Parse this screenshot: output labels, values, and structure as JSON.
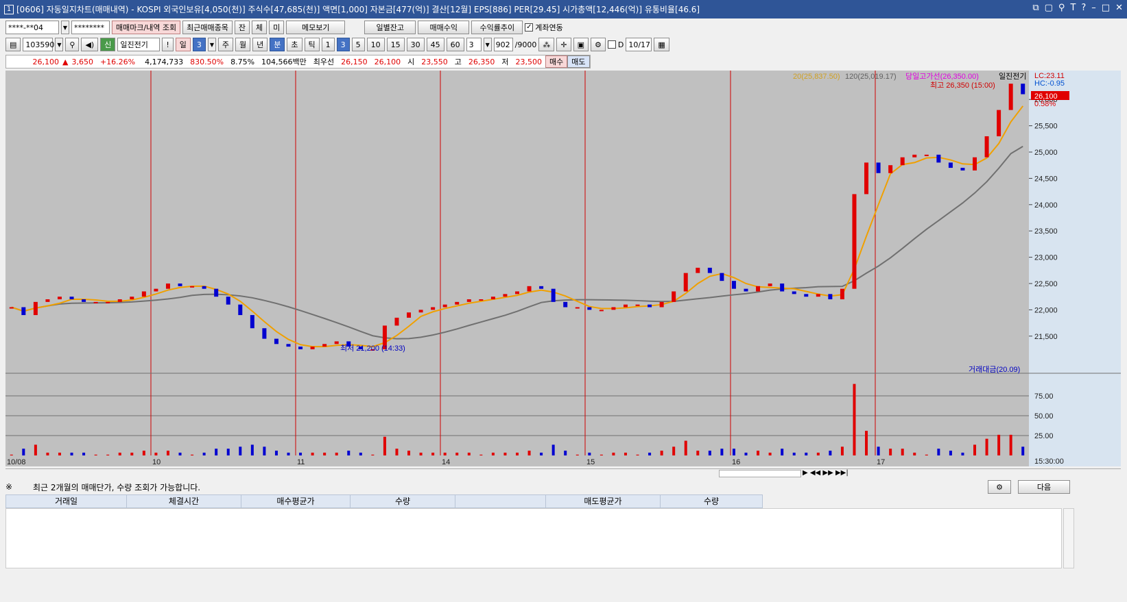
{
  "title": {
    "window_num": "1",
    "text": "[0606] 자동일지차트(매매내역) - KOSPI 외국인보유[4,050(천)] 주식수[47,685(천)] 액면[1,000] 자본금[477(억)] 결산[12월] EPS[886] PER[29.45] 시가총액[12,446(억)] 유통비율[46.6]"
  },
  "toolbar1": {
    "account": "****-**04",
    "password": "********",
    "trade_mark_btn": "매매마크/내역 조회",
    "recent_btn": "최근매매종목",
    "jan": "잔",
    "che": "체",
    "mi": "미",
    "memo_btn": "메모보기",
    "daily_balance_btn": "일별잔고",
    "trade_profit_btn": "매매수익",
    "profit_trend_btn": "수익률추이",
    "account_link_label": "계좌연동"
  },
  "toolbar2": {
    "code": "103590",
    "name": "일진전기",
    "exclam": "!",
    "period_il": "일",
    "period_num": "3",
    "week": "주",
    "month": "월",
    "year": "년",
    "minute": "분",
    "second": "초",
    "tick": "틱",
    "intervals": [
      "1",
      "3",
      "5",
      "10",
      "15",
      "30",
      "45",
      "60"
    ],
    "interval_select": "3",
    "count": "902",
    "count_max": "/9000",
    "d_label": "D",
    "date": "10/17"
  },
  "pricebar": {
    "price": "26,100",
    "change": "3,650",
    "rate": "+16.26%",
    "volume": "4,174,733",
    "vol_rate": "830.50%",
    "turnover": "8.75%",
    "amount": "104,566백만",
    "best_label": "최우선",
    "best_ask": "26,150",
    "best_bid": "26,100",
    "open_label": "시",
    "open": "23,550",
    "high_label": "고",
    "high": "26,350",
    "low_label": "저",
    "low": "23,500",
    "buy_btn": "매수",
    "sell_btn": "매도"
  },
  "chart": {
    "legend_ma20": "20(25,837.50)",
    "legend_ma120": "120(25,019.17)",
    "legend_high_line": "당일고가선(26,350.00)",
    "legend_name": "일진전기",
    "lc": "LC:23.11",
    "hc": "HC:-0.95",
    "max_label": "최고 26,350 (15:00)",
    "min_label": "최저 21,200 (14:33)",
    "cur_price_tag": "26,100",
    "cur_pct": "0.58%",
    "volume_legend": "거래대금(20.09)",
    "time_label": "15:30:00",
    "colors": {
      "up": "#e00000",
      "down": "#0000d0",
      "ma20": "#f0a000",
      "ma120": "#707070",
      "highline": "#e000e0",
      "daysep": "#d00000"
    }
  },
  "chart_data": {
    "type": "line",
    "title": "",
    "y_ticks": [
      "26,000",
      "25,500",
      "25,000",
      "24,500",
      "24,000",
      "23,500",
      "23,000",
      "22,500",
      "22,000",
      "21,500"
    ],
    "volume_ticks": [
      "75.00",
      "50.00",
      "25.00"
    ],
    "day_labels": [
      "10/08",
      "10",
      "11",
      "14",
      "15",
      "16",
      "17"
    ],
    "ylim": [
      20950,
      26550
    ],
    "series": [
      {
        "values": [
          22050,
          21900,
          22150,
          22200,
          22250,
          22200,
          22150,
          22150,
          22150,
          22200,
          22250,
          22350,
          22400,
          22500,
          22450,
          22450,
          22400,
          22250,
          22100,
          21900,
          21650,
          21450,
          21350,
          21300,
          21250,
          21300,
          21350,
          21400,
          21300,
          21250,
          21250,
          21700,
          21850,
          21950,
          22000,
          22050,
          22100,
          22150,
          22200,
          22200,
          22250,
          22300,
          22350,
          22450,
          22400,
          22150,
          22050,
          22050,
          22000,
          22000,
          22050,
          22100,
          22100,
          22050,
          22150,
          22350,
          22700,
          22800,
          22700,
          22550,
          22400,
          22350,
          22450,
          22500,
          22350,
          22300,
          22250,
          22300,
          22200,
          22400,
          24200,
          24800,
          24600,
          24750,
          24900,
          24950,
          24950,
          24800,
          24700,
          24650,
          24900,
          25300,
          25800,
          26300,
          26100
        ]
      }
    ]
  },
  "bottom": {
    "note_mark": "※",
    "note": "최근 2개월의 매매단가, 수량 조회가 가능합니다.",
    "next_btn": "다음",
    "columns": [
      "거래일",
      "체결시간",
      "매수평균가",
      "수량",
      "",
      "매도평균가",
      "수량"
    ]
  }
}
